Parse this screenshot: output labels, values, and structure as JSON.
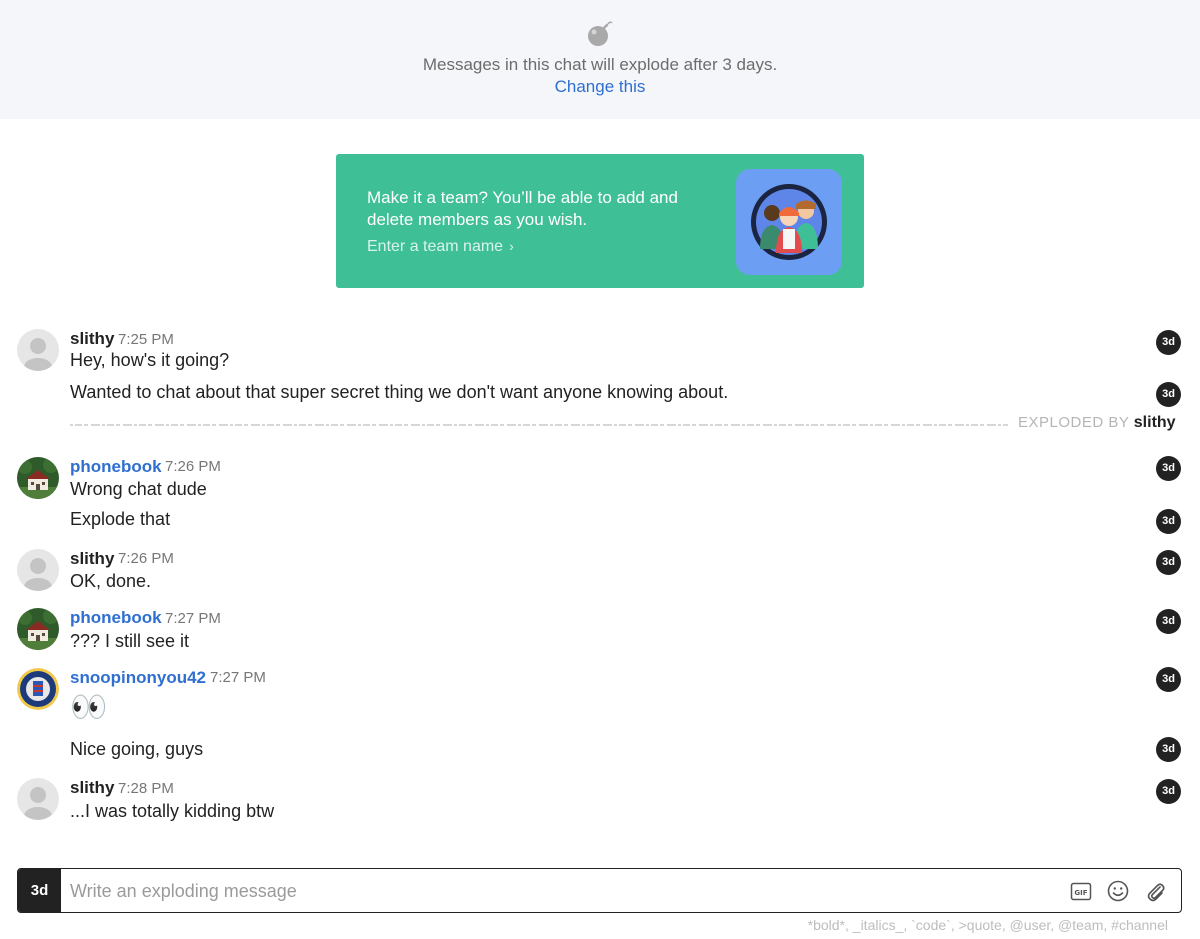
{
  "banner": {
    "text": "Messages in this chat will explode after 3 days.",
    "link": "Change this"
  },
  "team_card": {
    "text": "Make it a team? You’ll be able to add and delete members as you wish.",
    "link": "Enter a team name"
  },
  "badge_label": "3d",
  "messages": [
    {
      "user": "slithy",
      "time": "7:25 PM",
      "lines": [
        "Hey, how's it going?",
        "Wanted to chat about that super secret thing we don't want anyone knowing about."
      ]
    },
    {
      "exploded_label": "EXPLODED BY",
      "exploded_by": "slithy"
    },
    {
      "user": "phonebook",
      "time": "7:26 PM",
      "lines": [
        "Wrong chat dude",
        "Explode that"
      ]
    },
    {
      "user": "slithy",
      "time": "7:26 PM",
      "lines": [
        "OK, done."
      ]
    },
    {
      "user": "phonebook",
      "time": "7:27 PM",
      "lines": [
        "??? I still see it"
      ]
    },
    {
      "user": "snoopinonyou42",
      "time": "7:27 PM",
      "lines": [
        "👀",
        "Nice going, guys"
      ]
    },
    {
      "user": "slithy",
      "time": "7:28 PM",
      "lines": [
        "...I was totally kidding btw"
      ]
    }
  ],
  "composer": {
    "timer": "3d",
    "placeholder": "Write an exploding message",
    "gif_label": "GIF"
  },
  "formatting_hint": "*bold*, _italics_, `code`, >quote, @user, @team, #channel",
  "colors": {
    "accent_blue": "#2f6fd1",
    "team_green": "#3fbf95",
    "banner_bg": "#f4f6fa",
    "badge_black": "#222222"
  }
}
